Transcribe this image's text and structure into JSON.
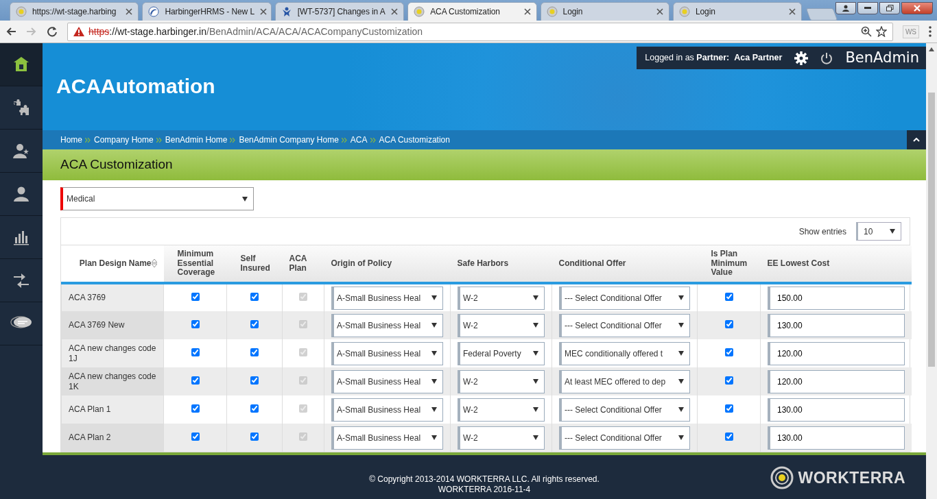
{
  "browser": {
    "tabs": [
      {
        "title": "https://wt-stage.harbing",
        "kind": "ring",
        "selected": false
      },
      {
        "title": "HarbingerHRMS - New L",
        "kind": "swirl",
        "selected": false
      },
      {
        "title": "[WT-5737] Changes in A",
        "kind": "figure",
        "selected": false
      },
      {
        "title": "ACA Customization",
        "kind": "ring",
        "selected": true
      },
      {
        "title": "Login",
        "kind": "ring",
        "selected": false
      },
      {
        "title": "Login",
        "kind": "ring",
        "selected": false
      }
    ],
    "address": {
      "scheme": "https",
      "host": "://wt-stage.harbinger.in",
      "path": "/BenAdmin/ACA/ACA/ACACompanyCustomization",
      "insecure": true
    },
    "extension": "WS"
  },
  "topbar": {
    "prefix": "Logged in as",
    "role": "Partner:",
    "user": "Aca Partner",
    "app": "BenAdmin"
  },
  "sidebar": {
    "items": [
      {
        "kind": "home",
        "selected": true
      },
      {
        "kind": "puzzle",
        "selected": false
      },
      {
        "kind": "person-star",
        "selected": false
      },
      {
        "kind": "person",
        "selected": false
      },
      {
        "kind": "chart",
        "selected": false
      },
      {
        "kind": "transfer",
        "selected": false
      },
      {
        "kind": "chat",
        "selected": false
      }
    ]
  },
  "header": {
    "title": "ACAAutomation"
  },
  "breadcrumbs": [
    "Home",
    "Company Home",
    "BenAdmin Home",
    "BenAdmin Company Home",
    "ACA",
    "ACA Customization"
  ],
  "page_title": "ACA Customization",
  "benefit_type": {
    "value": "Medical",
    "required": true
  },
  "show_entries": {
    "label": "Show entries",
    "value": "10"
  },
  "table": {
    "columns": [
      {
        "label": "Plan Design Name",
        "kind": "text",
        "sortable": true
      },
      {
        "label": "Minimum Essential Coverage",
        "kind": "checkbox",
        "sortable": false
      },
      {
        "label": "Self Insured",
        "kind": "checkbox",
        "sortable": false
      },
      {
        "label": "ACA Plan",
        "kind": "checkbox",
        "sortable": false
      },
      {
        "label": "Origin of Policy",
        "kind": "select",
        "sortable": false
      },
      {
        "label": "Safe Harbors",
        "kind": "select",
        "sortable": false
      },
      {
        "label": "Conditional Offer",
        "kind": "select",
        "sortable": false
      },
      {
        "label": "Is Plan Minimum Value",
        "kind": "checkbox",
        "sortable": false
      },
      {
        "label": "EE Lowest Cost",
        "kind": "input",
        "sortable": false
      }
    ],
    "rows": [
      {
        "cells": [
          "ACA 3769",
          {
            "checked": true,
            "disabled": false
          },
          {
            "checked": true,
            "disabled": false
          },
          {
            "checked": true,
            "disabled": true
          },
          "A-Small Business Heal",
          "W-2",
          "--- Select Conditional Offer",
          {
            "checked": true,
            "disabled": false
          },
          "150.00"
        ]
      },
      {
        "cells": [
          "ACA 3769 New",
          {
            "checked": true,
            "disabled": false
          },
          {
            "checked": true,
            "disabled": false
          },
          {
            "checked": true,
            "disabled": true
          },
          "A-Small Business Heal",
          "W-2",
          "--- Select Conditional Offer",
          {
            "checked": true,
            "disabled": false
          },
          "130.00"
        ]
      },
      {
        "cells": [
          "ACA new changes code 1J",
          {
            "checked": true,
            "disabled": false
          },
          {
            "checked": true,
            "disabled": false
          },
          {
            "checked": true,
            "disabled": true
          },
          "A-Small Business Heal",
          "Federal Poverty",
          "MEC conditionally offered t",
          {
            "checked": true,
            "disabled": false
          },
          "120.00"
        ]
      },
      {
        "cells": [
          "ACA new changes code 1K",
          {
            "checked": true,
            "disabled": false
          },
          {
            "checked": true,
            "disabled": false
          },
          {
            "checked": true,
            "disabled": true
          },
          "A-Small Business Heal",
          "W-2",
          "At least MEC offered to dep",
          {
            "checked": true,
            "disabled": false
          },
          "120.00"
        ]
      },
      {
        "cells": [
          "ACA Plan 1",
          {
            "checked": true,
            "disabled": false
          },
          {
            "checked": true,
            "disabled": false
          },
          {
            "checked": true,
            "disabled": true
          },
          "A-Small Business Heal",
          "W-2",
          "--- Select Conditional Offer",
          {
            "checked": true,
            "disabled": false
          },
          "130.00"
        ]
      },
      {
        "cells": [
          "ACA Plan 2",
          {
            "checked": true,
            "disabled": false
          },
          {
            "checked": true,
            "disabled": false
          },
          {
            "checked": true,
            "disabled": true
          },
          "A-Small Business Heal",
          "W-2",
          "--- Select Conditional Offer",
          {
            "checked": true,
            "disabled": false
          },
          "130.00"
        ]
      }
    ]
  },
  "footer": {
    "copyright": "© Copyright 2013-2014 WORKTERRA LLC. All rights reserved.",
    "version": "WORKTERRA 2016-11-4",
    "logo": "WORKTERRA"
  }
}
